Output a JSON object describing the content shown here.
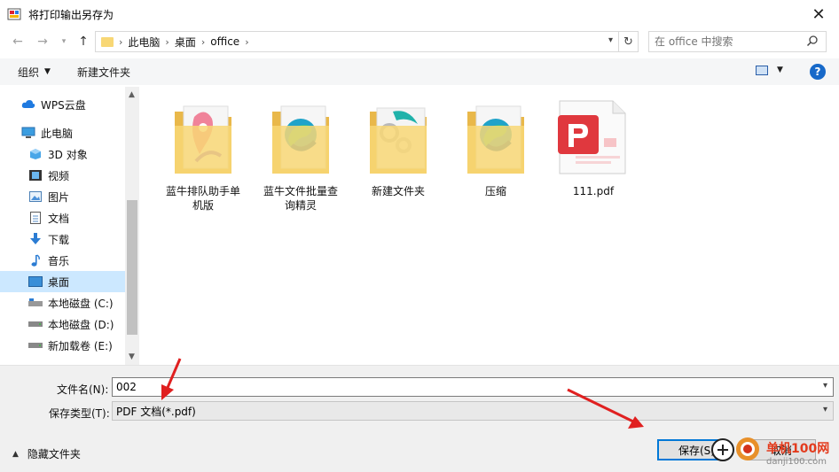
{
  "window": {
    "title": "将打印输出另存为",
    "close_glyph": "✕"
  },
  "address": {
    "crumbs": [
      "此电脑",
      "桌面",
      "office"
    ],
    "search_placeholder": "在 office 中搜索"
  },
  "toolbar": {
    "organize_label": "组织",
    "new_folder_label": "新建文件夹",
    "help_glyph": "?"
  },
  "nav": {
    "items": [
      {
        "label": "WPS云盘",
        "icon": "cloud-icon"
      },
      {
        "label": "此电脑",
        "icon": "computer-icon"
      },
      {
        "label": "3D 对象",
        "icon": "cube-icon"
      },
      {
        "label": "视频",
        "icon": "video-icon"
      },
      {
        "label": "图片",
        "icon": "picture-icon"
      },
      {
        "label": "文档",
        "icon": "document-icon"
      },
      {
        "label": "下载",
        "icon": "download-icon"
      },
      {
        "label": "音乐",
        "icon": "music-icon"
      },
      {
        "label": "桌面",
        "icon": "desktop-icon",
        "selected": true
      },
      {
        "label": "本地磁盘 (C:)",
        "icon": "drive-icon"
      },
      {
        "label": "本地磁盘 (D:)",
        "icon": "drive-icon"
      },
      {
        "label": "新加载卷 (E:)",
        "icon": "drive-icon"
      }
    ]
  },
  "files": [
    {
      "name_line1": "蓝牛排队助手单",
      "name_line2": "机版",
      "icon": "folder-map-icon"
    },
    {
      "name_line1": "蓝牛文件批量查",
      "name_line2": "询精灵",
      "icon": "folder-edge-icon"
    },
    {
      "name_line1": "新建文件夹",
      "name_line2": "",
      "icon": "folder-gear-icon"
    },
    {
      "name_line1": "压缩",
      "name_line2": "",
      "icon": "folder-edge-icon"
    },
    {
      "name_line1": "111.pdf",
      "name_line2": "",
      "icon": "pdf-icon"
    }
  ],
  "form": {
    "filename_label": "文件名(N):",
    "filename_value": "002",
    "filetype_label": "保存类型(T):",
    "filetype_value": "PDF 文档(*.pdf)",
    "hide_folders_label": "隐藏文件夹",
    "save_label": "保存(S)",
    "cancel_label": "取消"
  },
  "watermark": {
    "text": "单机100网",
    "url": "danji100.com"
  },
  "colors": {
    "accent": "#0078d7",
    "selection": "#cce8ff",
    "arrow": "#e02020",
    "folder": "#f8d775",
    "pdf": "#e0383e"
  }
}
